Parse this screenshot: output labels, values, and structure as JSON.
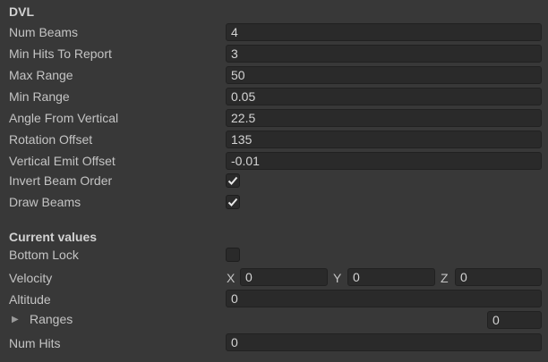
{
  "dvl": {
    "header": "DVL",
    "num_beams": {
      "label": "Num Beams",
      "value": "4"
    },
    "min_hits": {
      "label": "Min Hits To Report",
      "value": "3"
    },
    "max_range": {
      "label": "Max Range",
      "value": "50"
    },
    "min_range": {
      "label": "Min Range",
      "value": "0.05"
    },
    "angle": {
      "label": "Angle From Vertical",
      "value": "22.5"
    },
    "rotation": {
      "label": "Rotation Offset",
      "value": "135"
    },
    "vertical_emit": {
      "label": "Vertical Emit Offset",
      "value": "-0.01"
    },
    "invert_beam": {
      "label": "Invert Beam Order",
      "checked": true
    },
    "draw_beams": {
      "label": "Draw Beams",
      "checked": true
    }
  },
  "current": {
    "header": "Current values",
    "bottom_lock": {
      "label": "Bottom Lock",
      "checked": false
    },
    "velocity": {
      "label": "Velocity",
      "x_label": "X",
      "x": "0",
      "y_label": "Y",
      "y": "0",
      "z_label": "Z",
      "z": "0"
    },
    "altitude": {
      "label": "Altitude",
      "value": "0"
    },
    "ranges": {
      "label": "Ranges",
      "size": "0"
    },
    "num_hits": {
      "label": "Num Hits",
      "value": "0"
    }
  },
  "icons": {
    "check": "checkmark-icon",
    "foldout": "triangle-right-icon"
  },
  "colors": {
    "background": "#383838",
    "field": "#2a2a2a",
    "text": "#c4c4c4"
  }
}
